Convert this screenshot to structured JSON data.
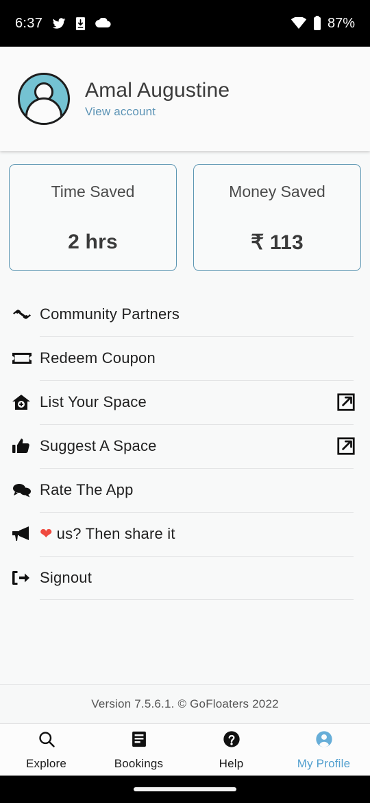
{
  "status_bar": {
    "time": "6:37",
    "battery": "87%",
    "icons": [
      "twitter-icon",
      "download-icon",
      "cloud-icon",
      "wifi-icon",
      "battery-icon"
    ]
  },
  "profile": {
    "name": "Amal Augustine",
    "view_account_label": "View account",
    "avatar_icon": "person-avatar",
    "avatar_color": "#74c2d2"
  },
  "stats": [
    {
      "label": "Time Saved",
      "value": "2 hrs"
    },
    {
      "label": "Money Saved",
      "value": "₹ 113"
    }
  ],
  "menu": [
    {
      "label": "Community Partners",
      "icon": "handshake-icon",
      "external": false
    },
    {
      "label": "Redeem Coupon",
      "icon": "ticket-icon",
      "external": false
    },
    {
      "label": "List Your Space",
      "icon": "home-plus-icon",
      "external": true
    },
    {
      "label": "Suggest A Space",
      "icon": "thumbs-up-icon",
      "external": true
    },
    {
      "label": "Rate The App",
      "icon": "chat-bubbles-icon",
      "external": false
    },
    {
      "label": "us? Then share it",
      "prefix": "❤",
      "icon": "megaphone-icon",
      "external": false
    },
    {
      "label": "Signout",
      "icon": "logout-icon",
      "external": false
    }
  ],
  "footer": {
    "version_text": "Version 7.5.6.1. © GoFloaters 2022"
  },
  "tabs": [
    {
      "label": "Explore",
      "icon": "search-icon",
      "active": false
    },
    {
      "label": "Bookings",
      "icon": "list-icon",
      "active": false
    },
    {
      "label": "Help",
      "icon": "question-icon",
      "active": false
    },
    {
      "label": "My Profile",
      "icon": "person-icon",
      "active": true
    }
  ],
  "colors": {
    "accent": "#53a0cf",
    "card_border": "#5e97b3",
    "heart": "#ef4a3f"
  }
}
